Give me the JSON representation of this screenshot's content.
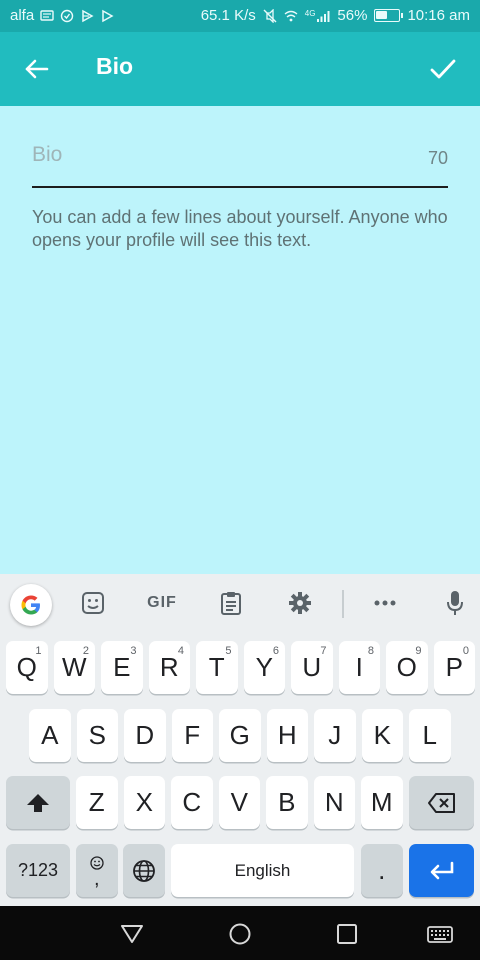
{
  "status_bar": {
    "carrier": "alfa",
    "speed": "65.1 K/s",
    "network": "4G",
    "battery": "56%",
    "battery_level": 0.56,
    "time": "10:16 am"
  },
  "app_bar": {
    "title": "Bio"
  },
  "bio_field": {
    "placeholder": "Bio",
    "value": "",
    "counter": "70"
  },
  "help_text": "You can add a few lines about yourself. Anyone who opens your profile will see this text.",
  "keyboard": {
    "toolbar": {
      "gif_label": "GIF"
    },
    "row1": [
      {
        "label": "Q",
        "hint": "1"
      },
      {
        "label": "W",
        "hint": "2"
      },
      {
        "label": "E",
        "hint": "3"
      },
      {
        "label": "R",
        "hint": "4"
      },
      {
        "label": "T",
        "hint": "5"
      },
      {
        "label": "Y",
        "hint": "6"
      },
      {
        "label": "U",
        "hint": "7"
      },
      {
        "label": "I",
        "hint": "8"
      },
      {
        "label": "O",
        "hint": "9"
      },
      {
        "label": "P",
        "hint": "0"
      }
    ],
    "row2": [
      "A",
      "S",
      "D",
      "F",
      "G",
      "H",
      "J",
      "K",
      "L"
    ],
    "row3": [
      "Z",
      "X",
      "C",
      "V",
      "B",
      "N",
      "M"
    ],
    "bottom": {
      "symbols_label": "?123",
      "comma_label": ",",
      "space_label": "English",
      "period_label": "."
    }
  },
  "colors": {
    "status_bar": "#1aa9ab",
    "app_bar": "#21bcbf",
    "background": "#bdf4fb",
    "enter_key": "#1a73e8"
  }
}
